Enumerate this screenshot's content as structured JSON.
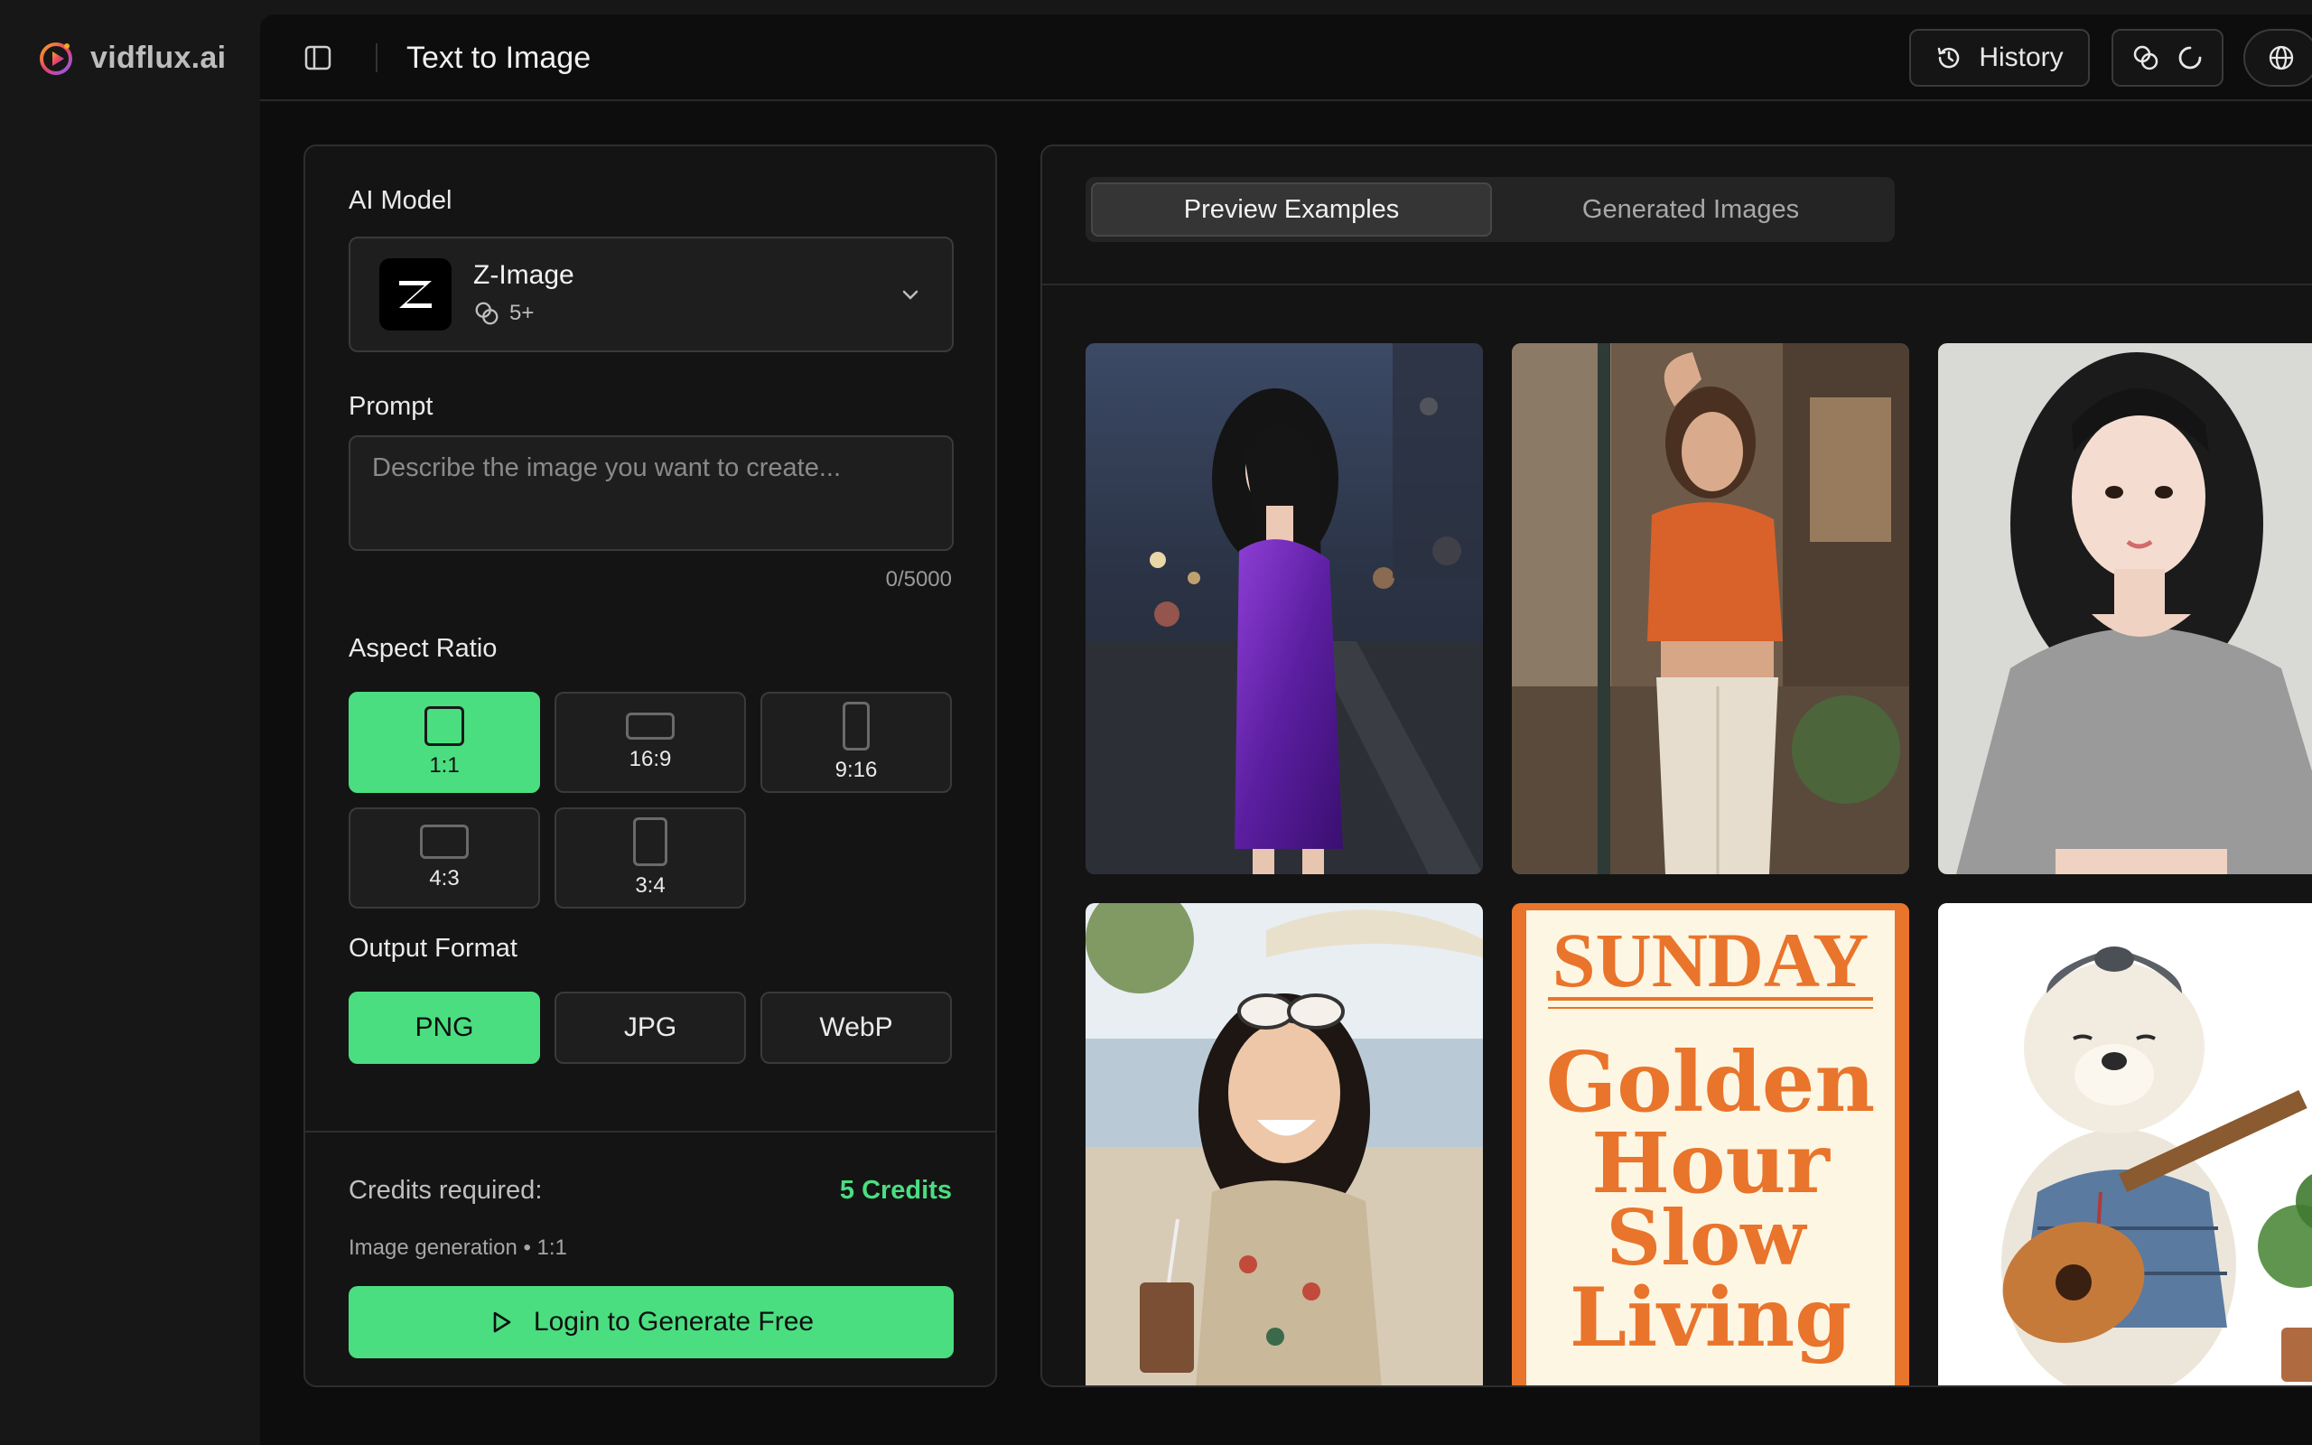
{
  "brand": {
    "name": "vidflux.ai"
  },
  "header": {
    "title": "Text to Image",
    "history_label": "History"
  },
  "settings": {
    "model_label": "AI Model",
    "model": {
      "name": "Z-Image",
      "logo_text": "Z",
      "cost": "5+"
    },
    "prompt_label": "Prompt",
    "prompt_placeholder": "Describe the image you want to create...",
    "prompt_value": "",
    "prompt_counter": "0/5000",
    "aspect_label": "Aspect Ratio",
    "aspect_ratios": [
      {
        "label": "1:1",
        "selected": true
      },
      {
        "label": "16:9",
        "selected": false
      },
      {
        "label": "9:16",
        "selected": false
      },
      {
        "label": "4:3",
        "selected": false
      },
      {
        "label": "3:4",
        "selected": false
      }
    ],
    "format_label": "Output Format",
    "formats": [
      {
        "label": "PNG",
        "selected": true
      },
      {
        "label": "JPG",
        "selected": false
      },
      {
        "label": "WebP",
        "selected": false
      }
    ],
    "credits_label": "Credits required:",
    "credits_value": "5 Credits",
    "credits_sub": "Image generation • 1:1",
    "login_label": "Login to Generate Free"
  },
  "gallery": {
    "tabs": [
      {
        "label": "Preview Examples",
        "active": true
      },
      {
        "label": "Generated Images",
        "active": false
      }
    ],
    "poster": {
      "line1": "SUNDAY",
      "line2": "Golden",
      "line3": "Hour",
      "line4": "Slow",
      "line5": "Living"
    }
  },
  "colors": {
    "accent": "#4ade80",
    "background": "#0d0d0d",
    "panel": "#141414",
    "poster_orange": "#e9742b",
    "poster_cream": "#fdf6e3"
  }
}
